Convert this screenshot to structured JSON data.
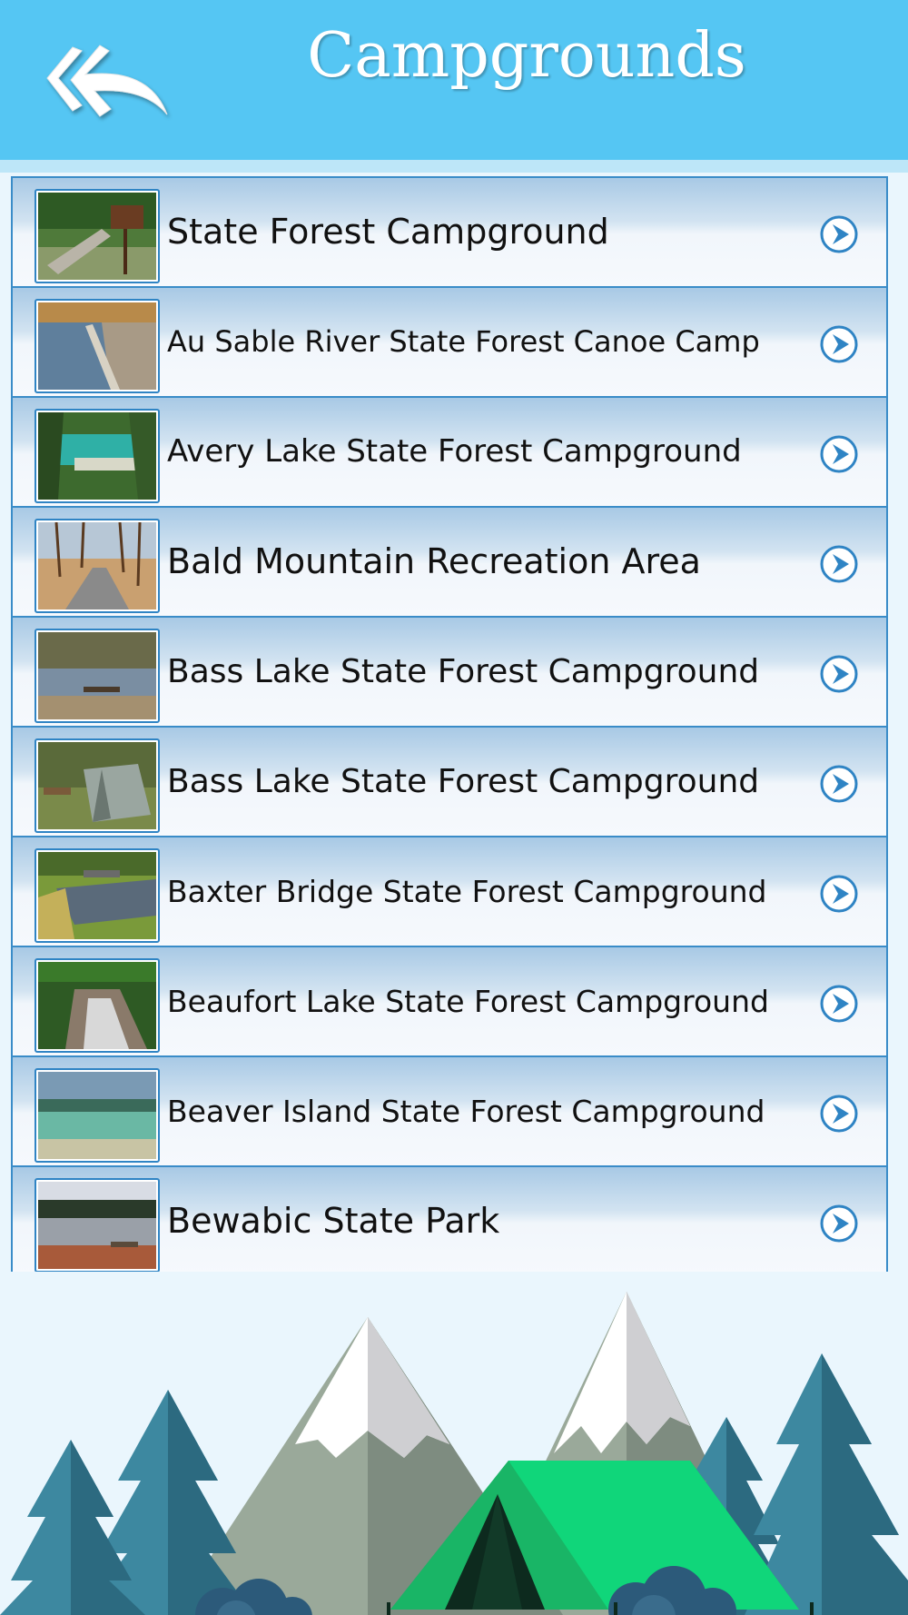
{
  "header": {
    "title": "Campgrounds",
    "back_icon": "double-back-arrow-icon"
  },
  "colors": {
    "header_bg": "#55c6f3",
    "row_border": "#3a8cc8",
    "arrow": "#2f84c4",
    "tent": "#10d67a"
  },
  "rows": [
    {
      "label": "State Forest Campground",
      "thumb": "footbridge-and-sign"
    },
    {
      "label": "Au Sable River State Forest Canoe Camp",
      "thumb": "river-bank"
    },
    {
      "label": "Avery Lake State Forest Campground",
      "thumb": "turquoise-lake"
    },
    {
      "label": "Bald Mountain Recreation Area",
      "thumb": "boardwalk-trail"
    },
    {
      "label": "Bass Lake State Forest Campground",
      "thumb": "lake-bench"
    },
    {
      "label": "Bass Lake State Forest Campground",
      "thumb": "tent-in-woods"
    },
    {
      "label": "Baxter Bridge State Forest Campground",
      "thumb": "river-bridge"
    },
    {
      "label": "Beaufort Lake State Forest Campground",
      "thumb": "forest-stream"
    },
    {
      "label": "Beaver Island State Forest Campground",
      "thumb": "coastline"
    },
    {
      "label": "Bewabic State Park",
      "thumb": "lakeside-picnic"
    }
  ],
  "illustration": "mountains-trees-tent"
}
